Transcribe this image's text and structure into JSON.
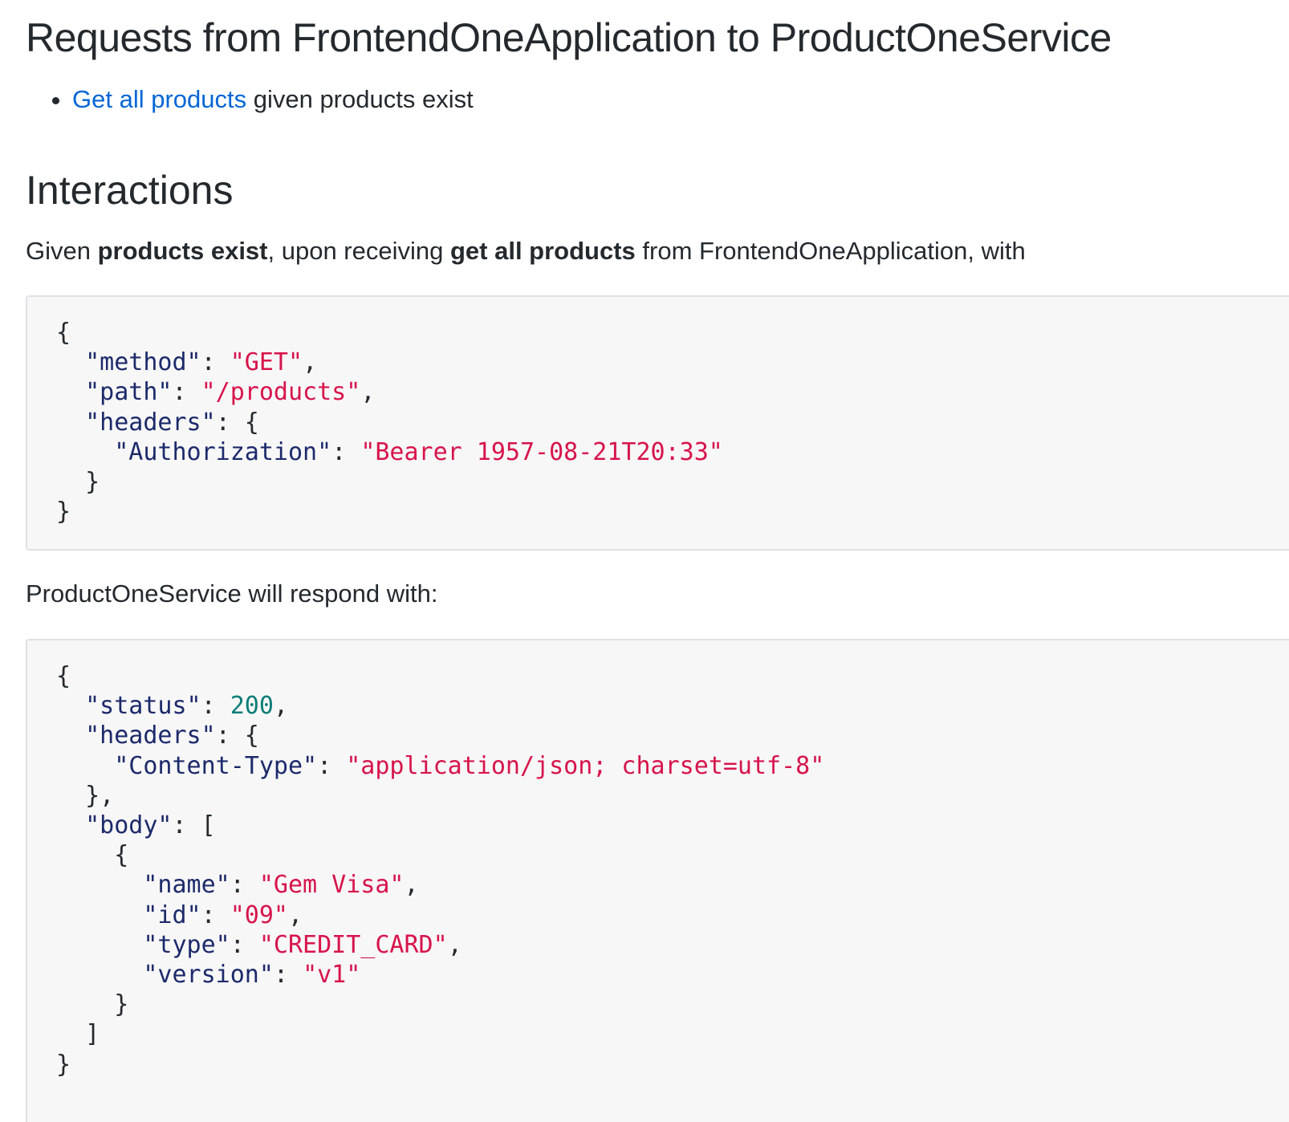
{
  "title": "Requests from FrontendOneApplication to ProductOneService",
  "requests": [
    {
      "link_text": "Get all products",
      "suffix": " given products exist"
    }
  ],
  "interactions_heading": "Interactions",
  "given_line": {
    "prefix": "Given ",
    "state": "products exist",
    "middle": ", upon receiving ",
    "description": "get all products",
    "suffix": " from FrontendOneApplication, with"
  },
  "request": {
    "method_key": "\"method\"",
    "method_value": "\"GET\"",
    "path_key": "\"path\"",
    "path_value": "\"/products\"",
    "headers_key": "\"headers\"",
    "auth_key": "\"Authorization\"",
    "auth_value": "\"Bearer 1957-08-21T20:33\""
  },
  "respond_line": "ProductOneService will respond with:",
  "response": {
    "status_key": "\"status\"",
    "status_value": "200",
    "headers_key": "\"headers\"",
    "content_type_key": "\"Content-Type\"",
    "content_type_value": "\"application/json; charset=utf-8\"",
    "body_key": "\"body\"",
    "item": {
      "name_key": "\"name\"",
      "name_value": "\"Gem Visa\"",
      "id_key": "\"id\"",
      "id_value": "\"09\"",
      "type_key": "\"type\"",
      "type_value": "\"CREDIT_CARD\"",
      "version_key": "\"version\"",
      "version_value": "\"v1\""
    }
  },
  "colors": {
    "link": "#0366d6",
    "json_key": "#1c2a6b",
    "json_string": "#d7144b",
    "json_number": "#0a7d77",
    "code_background": "#f7f7f7"
  }
}
